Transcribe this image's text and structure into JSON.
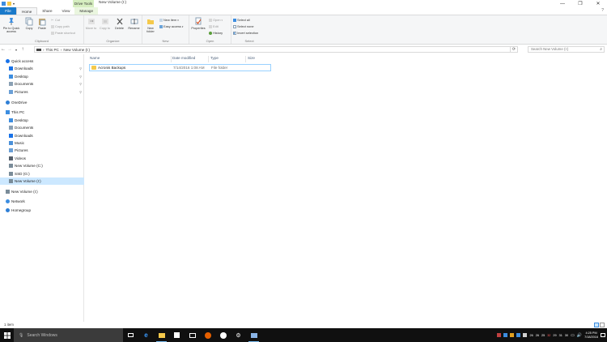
{
  "window": {
    "title": "New Volume (I:)",
    "context_tab_top": "Drive Tools",
    "controls": [
      "—",
      "❐",
      "✕"
    ]
  },
  "ribbon_tabs": {
    "file": "File",
    "home": "Home",
    "share": "Share",
    "view": "View",
    "manage": "Manage",
    "help": "?"
  },
  "ribbon": {
    "clipboard": {
      "label": "Clipboard",
      "pin": "Pin to Quick access",
      "copy": "Copy",
      "paste": "Paste",
      "cut": "Cut",
      "copy_path": "Copy path",
      "paste_shortcut": "Paste shortcut"
    },
    "organize": {
      "label": "Organize",
      "move_to": "Move to",
      "copy_to": "Copy to",
      "delete": "Delete",
      "rename": "Rename"
    },
    "new": {
      "label": "New",
      "new_folder": "New folder",
      "new_item": "New item",
      "easy_access": "Easy access"
    },
    "open": {
      "label": "Open",
      "properties": "Properties",
      "open": "Open",
      "edit": "Edit",
      "history": "History"
    },
    "select": {
      "label": "Select",
      "select_all": "Select all",
      "select_none": "Select none",
      "invert_selection": "Invert selection"
    }
  },
  "address": {
    "path": [
      "This PC",
      "New Volume (I:)"
    ],
    "search_placeholder": "Search New Volume (I:)"
  },
  "navpane": {
    "items": [
      {
        "label": "Quick access",
        "icon": "star-icon",
        "color": "#1a73e8",
        "indent": 0,
        "pinned": false
      },
      {
        "label": "Downloads",
        "icon": "download-icon",
        "color": "#1a73e8",
        "indent": 1,
        "pinned": true
      },
      {
        "label": "Desktop",
        "icon": "desktop-icon",
        "color": "#3c8de0",
        "indent": 1,
        "pinned": true
      },
      {
        "label": "Documents",
        "icon": "documents-icon",
        "color": "#8aa0b4",
        "indent": 1,
        "pinned": true
      },
      {
        "label": "Pictures",
        "icon": "pictures-icon",
        "color": "#6a9fd6",
        "indent": 1,
        "pinned": true
      },
      {
        "label": "OneDrive",
        "icon": "cloud-icon",
        "color": "#2f7fd6",
        "indent": 0,
        "pinned": false
      },
      {
        "label": "This PC",
        "icon": "computer-icon",
        "color": "#3c8de0",
        "indent": 0,
        "pinned": false
      },
      {
        "label": "Desktop",
        "icon": "desktop-icon",
        "color": "#3c8de0",
        "indent": 1,
        "pinned": false
      },
      {
        "label": "Documents",
        "icon": "documents-icon",
        "color": "#8aa0b4",
        "indent": 1,
        "pinned": false
      },
      {
        "label": "Downloads",
        "icon": "download-icon",
        "color": "#1a73e8",
        "indent": 1,
        "pinned": false
      },
      {
        "label": "Music",
        "icon": "music-icon",
        "color": "#4a90d9",
        "indent": 1,
        "pinned": false
      },
      {
        "label": "Pictures",
        "icon": "pictures-icon",
        "color": "#6a9fd6",
        "indent": 1,
        "pinned": false
      },
      {
        "label": "Videos",
        "icon": "video-icon",
        "color": "#555f6b",
        "indent": 1,
        "pinned": false
      },
      {
        "label": "New Volume (C:)",
        "icon": "drive-icon",
        "color": "#7a8c99",
        "indent": 1,
        "pinned": false
      },
      {
        "label": "SSD (G:)",
        "icon": "drive-icon",
        "color": "#7a8c99",
        "indent": 1,
        "pinned": false
      },
      {
        "label": "New Volume (I:)",
        "icon": "drive-icon",
        "color": "#7a8c99",
        "indent": 1,
        "pinned": false,
        "selected": true
      },
      {
        "label": "New Volume (I:)",
        "icon": "drive-icon",
        "color": "#7a8c99",
        "indent": 0,
        "pinned": false
      },
      {
        "label": "Network",
        "icon": "network-icon",
        "color": "#3c8de0",
        "indent": 0,
        "pinned": false
      },
      {
        "label": "Homegroup",
        "icon": "homegroup-icon",
        "color": "#2f7fd6",
        "indent": 0,
        "pinned": false
      }
    ]
  },
  "file_list": {
    "columns": [
      "Name",
      "Date modified",
      "Type",
      "Size"
    ],
    "rows": [
      {
        "name": "Acronis Backups",
        "date": "7/14/2016 1:08 AM",
        "type": "File folder",
        "size": ""
      }
    ]
  },
  "status": {
    "count": "1 item"
  },
  "taskbar": {
    "search_placeholder": "Search Windows",
    "apps": [
      "task-view-icon",
      "edge-icon",
      "file-explorer-icon",
      "store-icon",
      "mail-icon",
      "firefox-icon",
      "xbox-icon",
      "settings-icon",
      "network-app-icon"
    ],
    "tray_temps": [
      "26",
      "26",
      "25",
      "32",
      "29",
      "31",
      "30"
    ],
    "time": "4:25 PM",
    "date": "7/18/2016"
  },
  "colors": {
    "accent": "#1979ca",
    "selection": "#cce8ff",
    "manage_tab": "#d6eec0",
    "taskbar": "#101010",
    "folder": "#f5c94b"
  }
}
